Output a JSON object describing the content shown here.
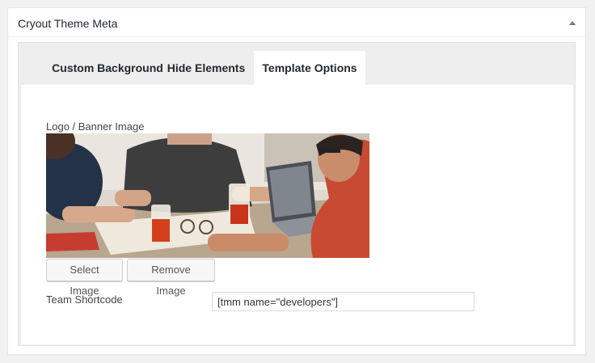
{
  "metabox": {
    "title": "Cryout Theme Meta",
    "toggle_icon": "triangle-up-icon"
  },
  "tabs": [
    {
      "label": "Custom Background",
      "active": false
    },
    {
      "label": "Hide Elements",
      "active": false
    },
    {
      "label": "Template Options",
      "active": true
    }
  ],
  "template_options": {
    "logo_label": "Logo / Banner Image",
    "select_button": "Select Image",
    "remove_button": "Remove Image",
    "shortcode_label": "Team Shortcode",
    "shortcode_value": "[tmm name=\"developers\"]"
  },
  "colors": {
    "panel_background": "#eeeeee",
    "active_tab": "#ffffff",
    "button_background": "#f7f7f7"
  }
}
